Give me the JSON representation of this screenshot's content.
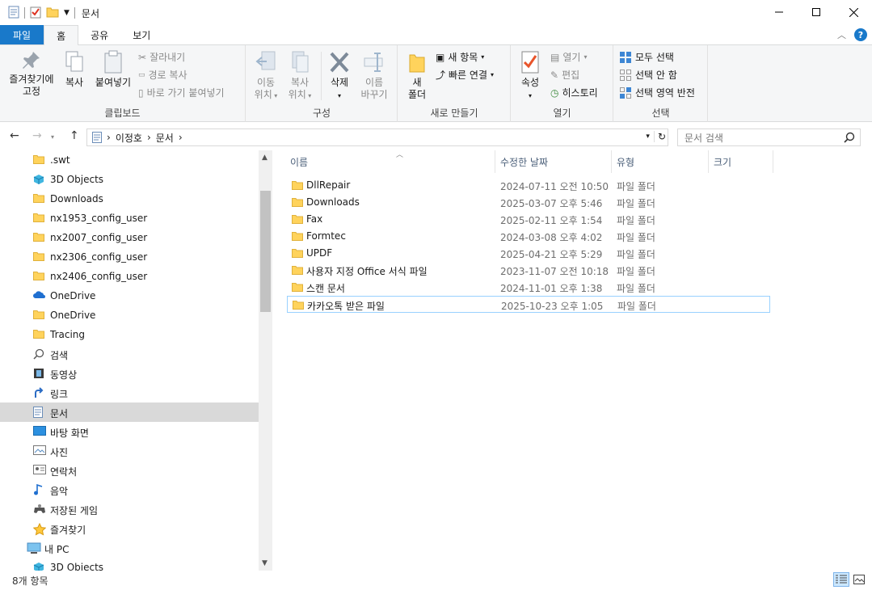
{
  "window": {
    "title": "문서",
    "controls": [
      "minimize-icon",
      "maximize-icon",
      "close-icon"
    ]
  },
  "ribbon_tabs": [
    "파일",
    "홈",
    "공유",
    "보기"
  ],
  "ribbon": {
    "clipboard": {
      "label": "클립보드",
      "pin": "즐겨찾기에\n고정",
      "copy": "복사",
      "paste": "붙여넣기",
      "cut": "잘라내기",
      "copy_path": "경로 복사",
      "paste_shortcut": "바로 가기 붙여넣기"
    },
    "organize": {
      "label": "구성",
      "move_to": "이동\n위치",
      "copy_to": "복사\n위치",
      "delete": "삭제",
      "rename": "이름\n바꾸기"
    },
    "new": {
      "label": "새로 만들기",
      "new_folder": "새\n폴더",
      "new_item": "새 항목",
      "easy_access": "빠른 연결"
    },
    "open": {
      "label": "열기",
      "properties": "속성",
      "open": "열기",
      "edit": "편집",
      "history": "히스토리"
    },
    "select": {
      "label": "선택",
      "select_all": "모두 선택",
      "select_none": "선택 안 함",
      "invert": "선택 영역 반전"
    }
  },
  "address": {
    "crumbs": [
      "이정호",
      "문서"
    ],
    "search_placeholder": "문서 검색"
  },
  "nav_items": [
    {
      "label": ".swt",
      "icon": "folder-icon"
    },
    {
      "label": "3D Objects",
      "icon": "3d-objects-icon"
    },
    {
      "label": "Downloads",
      "icon": "folder-icon"
    },
    {
      "label": "nx1953_config_user",
      "icon": "folder-icon"
    },
    {
      "label": "nx2007_config_user",
      "icon": "folder-icon"
    },
    {
      "label": "nx2306_config_user",
      "icon": "folder-icon"
    },
    {
      "label": "nx2406_config_user",
      "icon": "folder-icon"
    },
    {
      "label": "OneDrive",
      "icon": "onedrive-icon"
    },
    {
      "label": "OneDrive",
      "icon": "folder-icon"
    },
    {
      "label": "Tracing",
      "icon": "folder-icon"
    },
    {
      "label": "검색",
      "icon": "search-icon"
    },
    {
      "label": "동영상",
      "icon": "video-icon"
    },
    {
      "label": "링크",
      "icon": "link-icon"
    },
    {
      "label": "문서",
      "icon": "document-icon",
      "selected": true
    },
    {
      "label": "바탕 화면",
      "icon": "desktop-icon"
    },
    {
      "label": "사진",
      "icon": "pictures-icon"
    },
    {
      "label": "연락처",
      "icon": "contacts-icon"
    },
    {
      "label": "음악",
      "icon": "music-icon"
    },
    {
      "label": "저장된 게임",
      "icon": "saved-games-icon"
    },
    {
      "label": "즐겨찾기",
      "icon": "favorites-icon"
    },
    {
      "label": "내 PC",
      "icon": "pc-icon",
      "pc": true
    },
    {
      "label": "3D Objects",
      "icon": "3d-objects-icon"
    }
  ],
  "columns": [
    "이름",
    "수정한 날짜",
    "유형",
    "크기"
  ],
  "files": [
    {
      "name": "DllRepair",
      "date": "2024-07-11 오전 10:50",
      "type": "파일 폴더"
    },
    {
      "name": "Downloads",
      "date": "2025-03-07 오후 5:46",
      "type": "파일 폴더"
    },
    {
      "name": "Fax",
      "date": "2025-02-11 오후 1:54",
      "type": "파일 폴더"
    },
    {
      "name": "Formtec",
      "date": "2024-03-08 오후 4:02",
      "type": "파일 폴더"
    },
    {
      "name": "UPDF",
      "date": "2025-04-21 오후 5:29",
      "type": "파일 폴더"
    },
    {
      "name": "사용자 지정 Office 서식 파일",
      "date": "2023-11-07 오전 10:18",
      "type": "파일 폴더"
    },
    {
      "name": "스캔 문서",
      "date": "2024-11-01 오후 1:38",
      "type": "파일 폴더"
    },
    {
      "name": "카카오톡 받은 파일",
      "date": "2025-10-23 오후 1:05",
      "type": "파일 폴더",
      "focused": true
    }
  ],
  "status": {
    "count": "8개 항목"
  },
  "colors": {
    "accent": "#1979ca",
    "folder": "#ffd35c",
    "selection": "#d9d9d9",
    "focus_border": "#99d1ff"
  }
}
